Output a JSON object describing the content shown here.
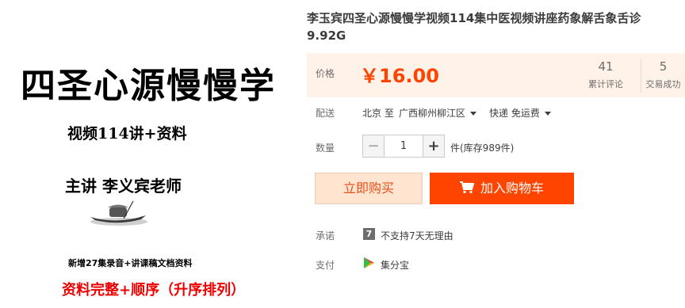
{
  "product_image": {
    "title": "四圣心源慢慢学",
    "line1": "视频114讲+资料",
    "line2": "主讲 李义宾老师",
    "note": "新增27集录音+讲课稿文档资料",
    "red_line": "资料完整+顺序（升序排列）"
  },
  "product": {
    "title": "李玉宾四圣心源慢慢学视频114集中医视频讲座药象解舌象舌诊9.92G"
  },
  "price": {
    "label": "价格",
    "value": "￥16.00",
    "reviews_count": "41",
    "reviews_label": "累计评论",
    "sales_count": "5",
    "sales_label": "交易成功"
  },
  "shipping": {
    "label": "配送",
    "from": "北京 至",
    "destination": "广西柳州柳江区",
    "method": "快递 免运费"
  },
  "quantity": {
    "label": "数量",
    "minus": "−",
    "value": "1",
    "plus": "+",
    "stock": "件(库存989件)"
  },
  "actions": {
    "buy_now": "立即购买",
    "add_to_cart": "加入购物车"
  },
  "promise": {
    "label": "承诺",
    "icon_char": "7",
    "text": "不支持7天无理由"
  },
  "payment": {
    "label": "支付",
    "text": "集分宝"
  },
  "colors": {
    "accent": "#ff4400",
    "price": "#ff4400",
    "price_bg": "#fff2e8"
  }
}
